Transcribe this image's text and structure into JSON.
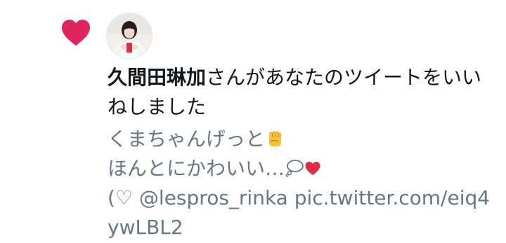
{
  "notification": {
    "user_name": "久間田琳加",
    "action_text": "さんがあなたのツイートをいいねしました",
    "tweet_line1": "くまちゃんげっと",
    "tweet_line2": "ほんとにかわいい…",
    "tweet_line3": "(♡ @lespros_rinka pic.twitter.com/eiq4ywLBL2",
    "heart_color": "#e0245e",
    "text_color": "#14171a",
    "secondary_color": "#657786",
    "icons": {
      "like": "heart-icon",
      "fist": "raised-fist-icon",
      "thought": "thought-bubble-icon",
      "small_heart": "red-heart-icon"
    }
  }
}
